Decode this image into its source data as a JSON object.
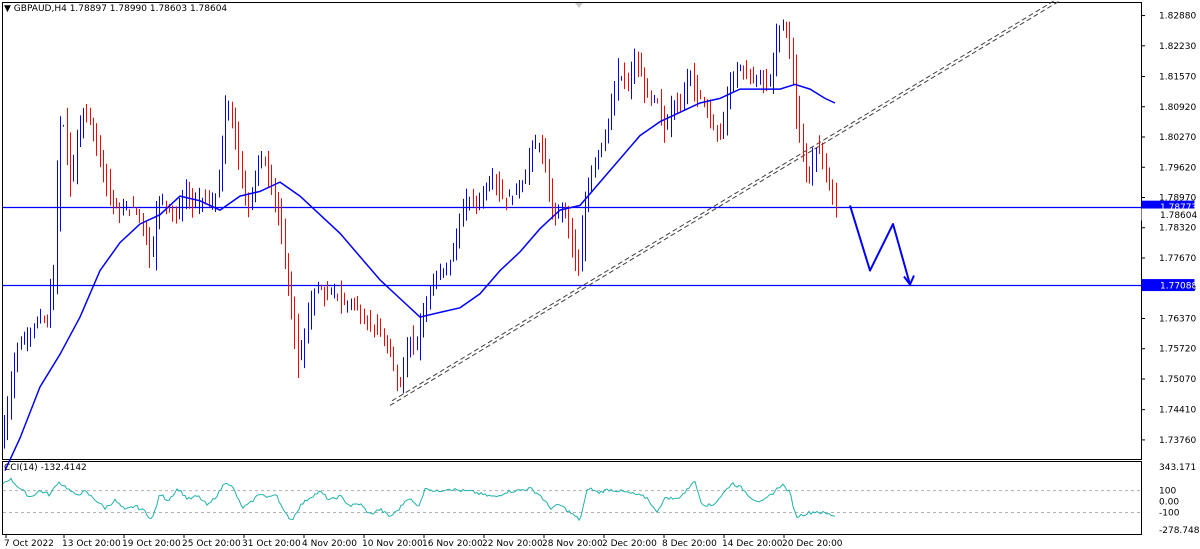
{
  "header": {
    "symbol": "GBPAUD,H4",
    "ohlc": "1.78897 1.78990 1.78603 1.78604",
    "menu_icon": "triangle-down-icon"
  },
  "indicator": {
    "name": "CCI(14)",
    "value": "-132.4142",
    "levels": [
      100,
      -100
    ],
    "range_labels": [
      "343.171",
      "100",
      "0.00",
      "-100",
      "-278.7487"
    ]
  },
  "colors": {
    "bull_candle": "#0000ff",
    "bear_candle": "#ff0000",
    "moving_average": "#0000ff",
    "level_line": "#0000ff",
    "trend_line": "#404040",
    "cci_line": "#20b2aa",
    "price_tag_bg": "#0000ff",
    "projection": "#0000ff"
  },
  "chart_data": {
    "type": "candlestick",
    "title": "",
    "xlabel": "",
    "ylabel": "",
    "ylim": [
      1.7335,
      1.8315
    ],
    "y_ticks": [
      1.8288,
      1.8223,
      1.8157,
      1.8092,
      1.8027,
      1.7962,
      1.7897,
      1.7832,
      1.7767,
      1.7702,
      1.7637,
      1.7572,
      1.7507,
      1.7441,
      1.7376
    ],
    "y_tick_labels": [
      "1.82880",
      "1.82230",
      "1.81570",
      "1.80920",
      "1.80270",
      "1.79620",
      "1.78970",
      "1.78320",
      "1.77670",
      "1.77020",
      "1.76370",
      "1.75720",
      "1.75070",
      "1.74410",
      "1.73760"
    ],
    "x_labels": [
      "7 Oct 2022",
      "13 Oct 20:00",
      "19 Oct 20:00",
      "25 Oct 20:00",
      "31 Oct 20:00",
      "4 Nov 20:00",
      "10 Nov 20:00",
      "16 Nov 20:00",
      "22 Nov 20:00",
      "28 Nov 20:00",
      "2 Dec 20:00",
      "8 Dec 20:00",
      "14 Dec 20:00",
      "20 Dec 20:00"
    ],
    "price_anchors": [
      [
        0,
        1.736
      ],
      [
        15,
        1.7575
      ],
      [
        25,
        1.76
      ],
      [
        40,
        1.764
      ],
      [
        47,
        1.762
      ],
      [
        50,
        1.771
      ],
      [
        53,
        1.77
      ],
      [
        58,
        1.805
      ],
      [
        62,
        1.808
      ],
      [
        66,
        1.8
      ],
      [
        70,
        1.79
      ],
      [
        75,
        1.802
      ],
      [
        82,
        1.808
      ],
      [
        90,
        1.806
      ],
      [
        96,
        1.801
      ],
      [
        102,
        1.796
      ],
      [
        110,
        1.789
      ],
      [
        118,
        1.786
      ],
      [
        126,
        1.788
      ],
      [
        135,
        1.787
      ],
      [
        144,
        1.783
      ],
      [
        150,
        1.774
      ],
      [
        155,
        1.788
      ],
      [
        160,
        1.789
      ],
      [
        168,
        1.788
      ],
      [
        175,
        1.785
      ],
      [
        185,
        1.792
      ],
      [
        192,
        1.787
      ],
      [
        200,
        1.79
      ],
      [
        210,
        1.788
      ],
      [
        218,
        1.792
      ],
      [
        225,
        1.811
      ],
      [
        232,
        1.806
      ],
      [
        240,
        1.793
      ],
      [
        248,
        1.787
      ],
      [
        255,
        1.796
      ],
      [
        262,
        1.799
      ],
      [
        270,
        1.793
      ],
      [
        278,
        1.785
      ],
      [
        286,
        1.772
      ],
      [
        292,
        1.764
      ],
      [
        297,
        1.752
      ],
      [
        305,
        1.762
      ],
      [
        312,
        1.77
      ],
      [
        320,
        1.77
      ],
      [
        328,
        1.768
      ],
      [
        335,
        1.77
      ],
      [
        342,
        1.766
      ],
      [
        350,
        1.768
      ],
      [
        358,
        1.765
      ],
      [
        366,
        1.763
      ],
      [
        374,
        1.762
      ],
      [
        382,
        1.759
      ],
      [
        390,
        1.755
      ],
      [
        397,
        1.749
      ],
      [
        402,
        1.752
      ],
      [
        408,
        1.762
      ],
      [
        414,
        1.756
      ],
      [
        420,
        1.764
      ],
      [
        428,
        1.769
      ],
      [
        436,
        1.773
      ],
      [
        444,
        1.774
      ],
      [
        452,
        1.778
      ],
      [
        460,
        1.786
      ],
      [
        468,
        1.79
      ],
      [
        476,
        1.788
      ],
      [
        484,
        1.792
      ],
      [
        492,
        1.795
      ],
      [
        500,
        1.79
      ],
      [
        508,
        1.789
      ],
      [
        516,
        1.792
      ],
      [
        524,
        1.794
      ],
      [
        530,
        1.8
      ],
      [
        538,
        1.802
      ],
      [
        545,
        1.795
      ],
      [
        552,
        1.785
      ],
      [
        560,
        1.788
      ],
      [
        566,
        1.785
      ],
      [
        572,
        1.778
      ],
      [
        578,
        1.772
      ],
      [
        583,
        1.788
      ],
      [
        590,
        1.796
      ],
      [
        598,
        1.8
      ],
      [
        605,
        1.804
      ],
      [
        612,
        1.81
      ],
      [
        618,
        1.818
      ],
      [
        626,
        1.812
      ],
      [
        633,
        1.82
      ],
      [
        640,
        1.816
      ],
      [
        648,
        1.81
      ],
      [
        656,
        1.811
      ],
      [
        664,
        1.803
      ],
      [
        672,
        1.812
      ],
      [
        680,
        1.808
      ],
      [
        688,
        1.819
      ],
      [
        696,
        1.811
      ],
      [
        704,
        1.81
      ],
      [
        712,
        1.804
      ],
      [
        720,
        1.803
      ],
      [
        728,
        1.813
      ],
      [
        736,
        1.818
      ],
      [
        744,
        1.817
      ],
      [
        752,
        1.815
      ],
      [
        760,
        1.816
      ],
      [
        768,
        1.813
      ],
      [
        776,
        1.825
      ],
      [
        784,
        1.827
      ],
      [
        790,
        1.821
      ],
      [
        796,
        1.806
      ],
      [
        802,
        1.798
      ],
      [
        808,
        1.792
      ],
      [
        814,
        1.802
      ],
      [
        820,
        1.798
      ],
      [
        826,
        1.794
      ],
      [
        832,
        1.79
      ],
      [
        837,
        1.786
      ]
    ],
    "moving_average": [
      [
        5,
        1.731
      ],
      [
        20,
        1.738
      ],
      [
        40,
        1.749
      ],
      [
        60,
        1.756
      ],
      [
        80,
        1.764
      ],
      [
        100,
        1.774
      ],
      [
        120,
        1.78
      ],
      [
        140,
        1.784
      ],
      [
        160,
        1.786
      ],
      [
        180,
        1.79
      ],
      [
        200,
        1.789
      ],
      [
        220,
        1.787
      ],
      [
        240,
        1.79
      ],
      [
        260,
        1.791
      ],
      [
        280,
        1.793
      ],
      [
        300,
        1.79
      ],
      [
        320,
        1.786
      ],
      [
        340,
        1.782
      ],
      [
        360,
        1.777
      ],
      [
        380,
        1.772
      ],
      [
        400,
        1.768
      ],
      [
        420,
        1.764
      ],
      [
        440,
        1.765
      ],
      [
        460,
        1.766
      ],
      [
        480,
        1.769
      ],
      [
        500,
        1.774
      ],
      [
        520,
        1.778
      ],
      [
        540,
        1.783
      ],
      [
        560,
        1.787
      ],
      [
        580,
        1.788
      ],
      [
        600,
        1.793
      ],
      [
        620,
        1.798
      ],
      [
        640,
        1.803
      ],
      [
        660,
        1.806
      ],
      [
        680,
        1.808
      ],
      [
        700,
        1.81
      ],
      [
        720,
        1.811
      ],
      [
        740,
        1.813
      ],
      [
        760,
        1.813
      ],
      [
        780,
        1.813
      ],
      [
        795,
        1.814
      ],
      [
        810,
        1.813
      ],
      [
        825,
        1.811
      ],
      [
        835,
        1.81
      ]
    ],
    "horizontal_levels": [
      {
        "price": 1.78773,
        "label": "1.78773"
      },
      {
        "price": 1.77088,
        "label": "1.77088"
      }
    ],
    "current_price": {
      "price": 1.78604,
      "label": "1.78604"
    },
    "trend_channel": [
      {
        "from": [
          390,
          1.745
        ],
        "to": [
          1060,
          1.832
        ]
      },
      {
        "from": [
          392,
          1.746
        ],
        "to": [
          1062,
          1.833
        ]
      }
    ],
    "projection_path": [
      [
        850,
        1.788
      ],
      [
        870,
        1.774
      ],
      [
        893,
        1.784
      ],
      [
        910,
        1.771
      ]
    ],
    "cci_range": [
      -278.7487,
      343.171
    ],
    "cci_anchors": [
      [
        0,
        150
      ],
      [
        10,
        210
      ],
      [
        20,
        120
      ],
      [
        30,
        40
      ],
      [
        40,
        100
      ],
      [
        50,
        60
      ],
      [
        58,
        180
      ],
      [
        65,
        140
      ],
      [
        75,
        60
      ],
      [
        85,
        90
      ],
      [
        95,
        20
      ],
      [
        105,
        -60
      ],
      [
        115,
        10
      ],
      [
        125,
        -80
      ],
      [
        135,
        -40
      ],
      [
        145,
        -90
      ],
      [
        152,
        -170
      ],
      [
        160,
        70
      ],
      [
        168,
        10
      ],
      [
        178,
        120
      ],
      [
        188,
        20
      ],
      [
        198,
        50
      ],
      [
        208,
        -40
      ],
      [
        218,
        70
      ],
      [
        226,
        190
      ],
      [
        234,
        110
      ],
      [
        242,
        -60
      ],
      [
        250,
        -20
      ],
      [
        260,
        80
      ],
      [
        268,
        30
      ],
      [
        276,
        80
      ],
      [
        284,
        -100
      ],
      [
        292,
        -170
      ],
      [
        300,
        -40
      ],
      [
        310,
        40
      ],
      [
        320,
        90
      ],
      [
        330,
        10
      ],
      [
        340,
        50
      ],
      [
        350,
        -40
      ],
      [
        360,
        -20
      ],
      [
        370,
        -120
      ],
      [
        380,
        -70
      ],
      [
        390,
        -140
      ],
      [
        400,
        -60
      ],
      [
        408,
        40
      ],
      [
        418,
        -50
      ],
      [
        426,
        130
      ],
      [
        436,
        90
      ],
      [
        448,
        120
      ],
      [
        460,
        100
      ],
      [
        472,
        90
      ],
      [
        484,
        60
      ],
      [
        496,
        40
      ],
      [
        506,
        90
      ],
      [
        518,
        100
      ],
      [
        530,
        120
      ],
      [
        540,
        60
      ],
      [
        550,
        -60
      ],
      [
        560,
        -30
      ],
      [
        570,
        -100
      ],
      [
        580,
        -170
      ],
      [
        588,
        130
      ],
      [
        598,
        80
      ],
      [
        608,
        110
      ],
      [
        618,
        100
      ],
      [
        628,
        80
      ],
      [
        638,
        60
      ],
      [
        648,
        30
      ],
      [
        656,
        -100
      ],
      [
        666,
        40
      ],
      [
        676,
        20
      ],
      [
        686,
        90
      ],
      [
        694,
        200
      ],
      [
        702,
        -20
      ],
      [
        712,
        -40
      ],
      [
        722,
        60
      ],
      [
        732,
        170
      ],
      [
        742,
        120
      ],
      [
        752,
        30
      ],
      [
        762,
        -10
      ],
      [
        772,
        70
      ],
      [
        782,
        160
      ],
      [
        790,
        80
      ],
      [
        796,
        -140
      ],
      [
        806,
        -110
      ],
      [
        816,
        -90
      ],
      [
        826,
        -110
      ],
      [
        836,
        -132
      ]
    ]
  }
}
